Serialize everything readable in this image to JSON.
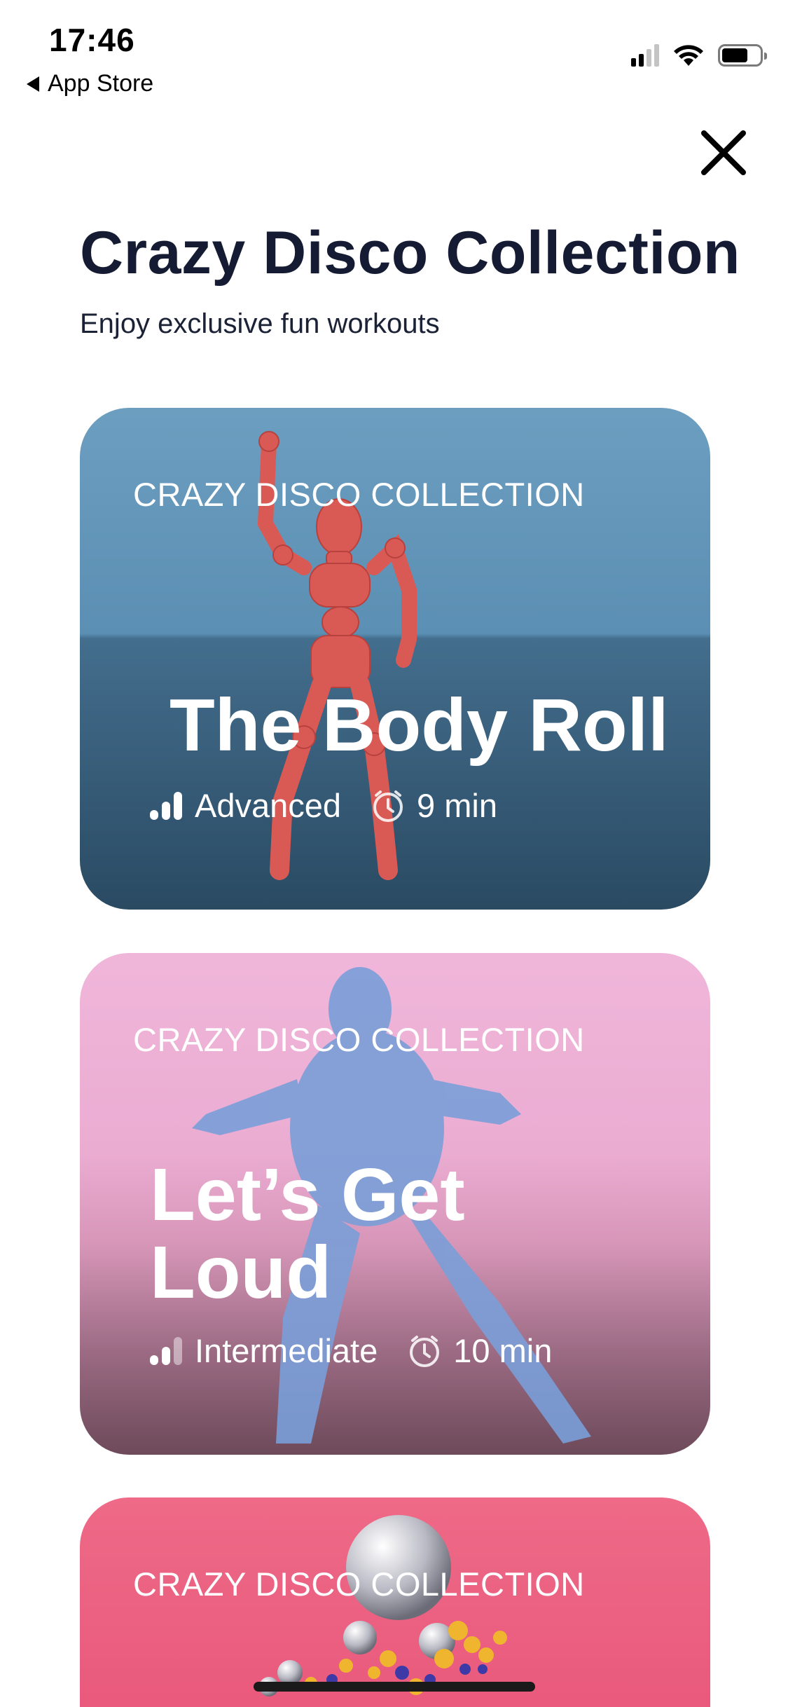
{
  "status_bar": {
    "time": "17:46",
    "back_app": "App Store"
  },
  "header": {
    "title": "Crazy Disco Collection",
    "subtitle": "Enjoy exclusive fun workouts"
  },
  "cards": [
    {
      "eyebrow": "CRAZY DISCO COLLECTION",
      "title": "The Body Roll",
      "level": "Advanced",
      "level_filled": 3,
      "duration": "9 min"
    },
    {
      "eyebrow": "CRAZY DISCO COLLECTION",
      "title": "Let’s Get Loud",
      "level": "Intermediate",
      "level_filled": 2,
      "duration": "10 min"
    },
    {
      "eyebrow": "CRAZY DISCO COLLECTION"
    }
  ],
  "colors": {
    "title": "#141b33",
    "card1": "#5b8fb3",
    "card2": "#ebacd2",
    "card3": "#e85479"
  },
  "icons": [
    "back-triangle-icon",
    "signal-icon",
    "wifi-icon",
    "battery-icon",
    "close-icon",
    "level-bars-icon",
    "timer-icon"
  ]
}
